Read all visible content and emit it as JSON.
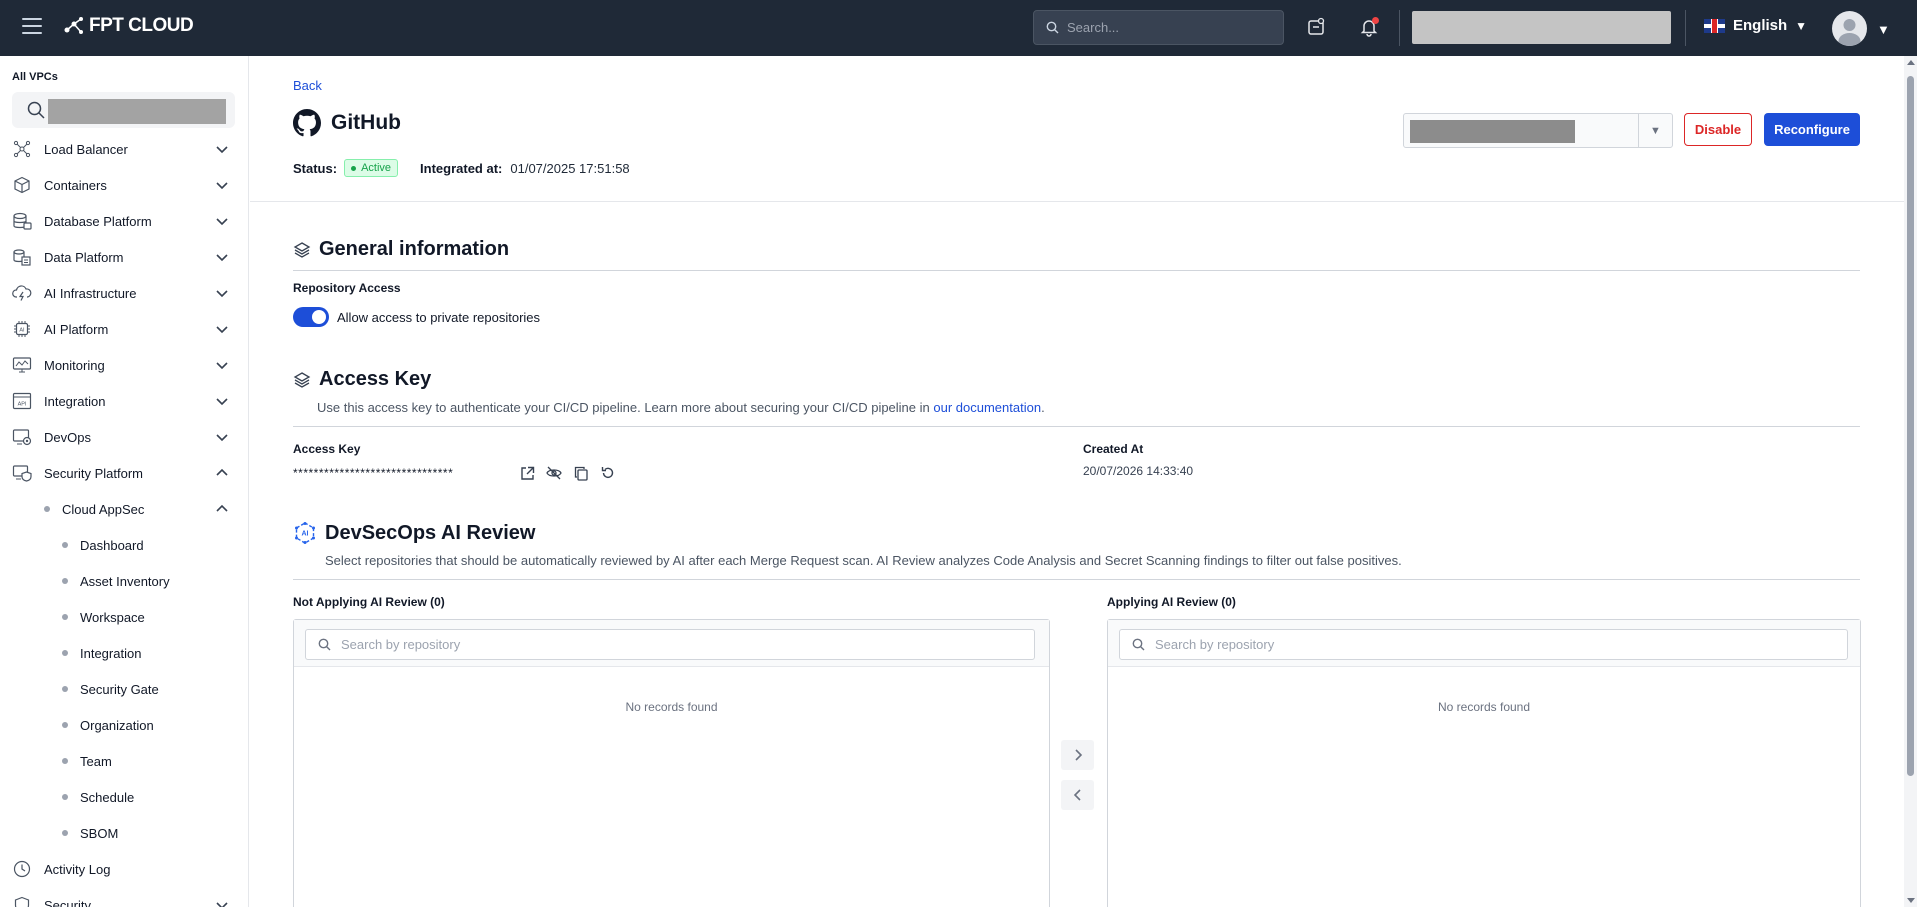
{
  "topbar": {
    "brand": "FPT CLOUD",
    "search_placeholder": "Search...",
    "language": "English"
  },
  "sidebar": {
    "vpc_label": "All VPCs",
    "items": [
      {
        "label": "Load Balancer",
        "icon": "load-balancer-icon"
      },
      {
        "label": "Containers",
        "icon": "containers-icon"
      },
      {
        "label": "Database Platform",
        "icon": "database-icon"
      },
      {
        "label": "Data Platform",
        "icon": "data-platform-icon"
      },
      {
        "label": "AI Infrastructure",
        "icon": "ai-infrastructure-icon"
      },
      {
        "label": "AI Platform",
        "icon": "ai-platform-icon"
      },
      {
        "label": "Monitoring",
        "icon": "monitoring-icon"
      },
      {
        "label": "Integration",
        "icon": "integration-icon"
      },
      {
        "label": "DevOps",
        "icon": "devops-icon"
      },
      {
        "label": "Security Platform",
        "icon": "security-platform-icon"
      }
    ],
    "cloud_appsec": "Cloud AppSec",
    "sub_items": [
      "Dashboard",
      "Asset Inventory",
      "Workspace",
      "Integration",
      "Security Gate",
      "Organization",
      "Team",
      "Schedule",
      "SBOM"
    ],
    "activity_log": "Activity Log",
    "security": "Security"
  },
  "header": {
    "back": "Back",
    "title": "GitHub",
    "status_label": "Status:",
    "status_value": "Active",
    "integrated_label": "Integrated at:",
    "integrated_value": "01/07/2025 17:51:58",
    "disable_label": "Disable",
    "reconfigure_label": "Reconfigure"
  },
  "general": {
    "title": "General information",
    "repo_access_label": "Repository Access",
    "toggle_label": "Allow access to private repositories"
  },
  "access_key": {
    "title": "Access Key",
    "desc": "Use this access key to authenticate your CI/CD pipeline. Learn more about securing your CI/CD pipeline in ",
    "link": "our documentation",
    "desc_end": ".",
    "key_label": "Access Key",
    "key_value": "*******************************",
    "created_label": "Created At",
    "created_value": "20/07/2026 14:33:40"
  },
  "ai_review": {
    "title": "DevSecOps AI Review",
    "desc": "Select repositories that should be automatically reviewed by AI after each Merge Request scan. AI Review analyzes Code Analysis and Secret Scanning findings to filter out false positives.",
    "not_applying_label": "Not Applying AI Review (0)",
    "applying_label": "Applying AI Review (0)",
    "search_placeholder": "Search by repository",
    "empty_text": "No records found"
  }
}
